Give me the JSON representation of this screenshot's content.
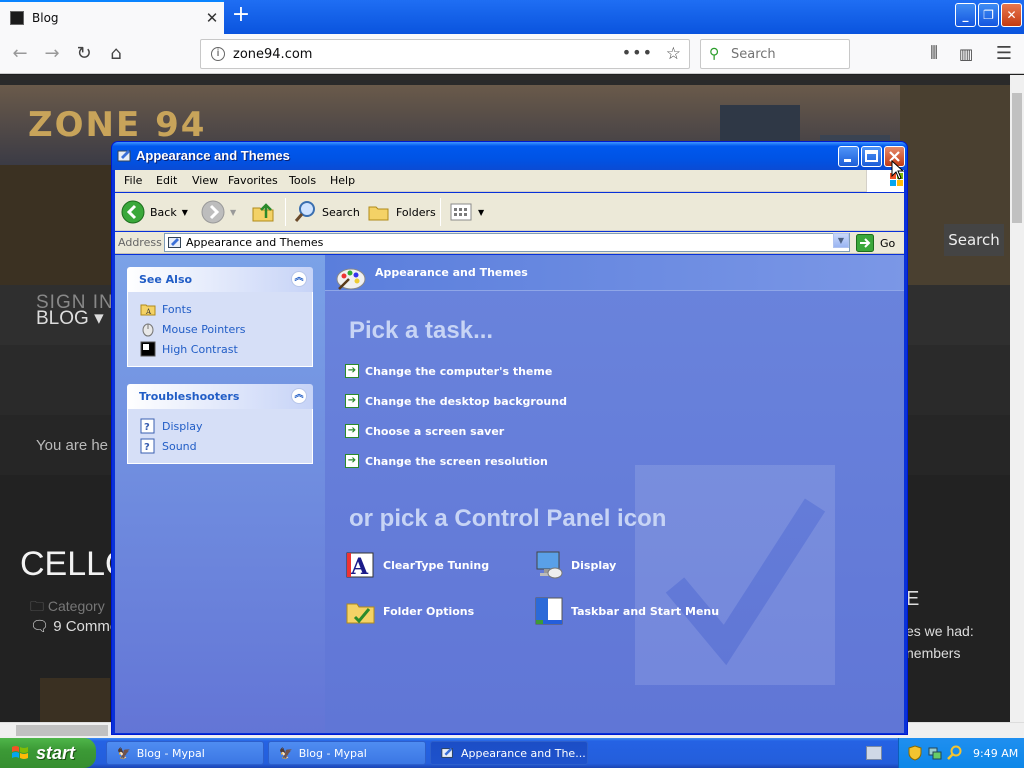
{
  "browser": {
    "tab_title": "Blog",
    "new_tab_symbol": "+",
    "url": "zone94.com",
    "search_placeholder": "Search",
    "page_actions_symbol": "•••"
  },
  "webpage": {
    "logo_text": "ZONE 94",
    "nav_blog": "BLOG",
    "search_button": "Search",
    "sign_in": "SIGN IN",
    "breadcrumb": "You are he",
    "post_title": "CELLO",
    "category": "Category",
    "comments": "9 Comme",
    "right_heading": "E",
    "right_line1": "es we had:",
    "right_line2": "nembers"
  },
  "explorer": {
    "title": "Appearance and Themes",
    "menu": [
      "File",
      "Edit",
      "View",
      "Favorites",
      "Tools",
      "Help"
    ],
    "toolbar": {
      "back": "Back",
      "search": "Search",
      "folders": "Folders"
    },
    "address_label": "Address",
    "address_value": "Appearance and Themes",
    "go_label": "Go",
    "see_also": {
      "title": "See Also",
      "items": [
        "Fonts",
        "Mouse Pointers",
        "High Contrast"
      ]
    },
    "troubleshooters": {
      "title": "Troubleshooters",
      "items": [
        "Display",
        "Sound"
      ]
    },
    "header_title": "Appearance and Themes",
    "pick_task": "Pick a task...",
    "tasks": [
      "Change the computer's theme",
      "Change the desktop background",
      "Choose a screen saver",
      "Change the screen resolution"
    ],
    "or_pick": "or pick a Control Panel icon",
    "icons": [
      "ClearType Tuning",
      "Display",
      "Folder Options",
      "Taskbar and Start Menu"
    ]
  },
  "taskbar": {
    "start": "start",
    "tasks": [
      "Blog - Mypal",
      "Blog - Mypal",
      "Appearance and The..."
    ],
    "clock": "9:49 AM"
  },
  "colors": {
    "xp_blue": "#0054e3",
    "task_pane": "#7ba2e7",
    "link_blue": "#215dc6",
    "start_green": "#3c9a36"
  }
}
